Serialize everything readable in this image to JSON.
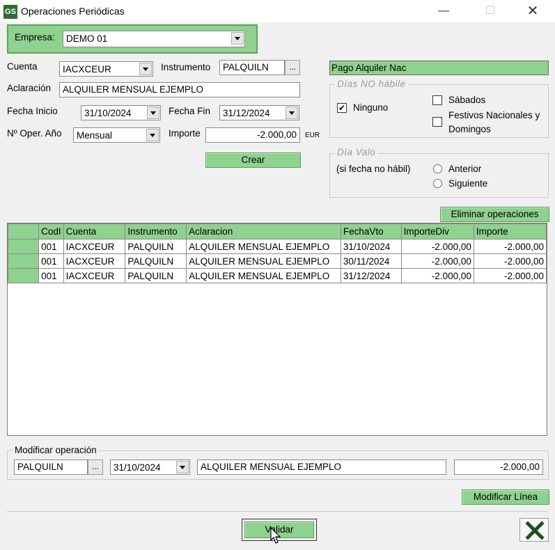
{
  "window": {
    "app_icon": "GS",
    "title": "Operaciones Periódicas",
    "minimize_icon": "minimize-icon",
    "maximize_icon": "maximize-icon",
    "close_icon": "close-icon"
  },
  "empresa": {
    "label": "Empresa:",
    "value": "DEMO 01"
  },
  "form": {
    "cuenta_label": "Cuenta",
    "cuenta_value": "IACXCEUR",
    "instrumento_label": "Instrumento",
    "instrumento_value": "PALQUILN",
    "ellipsis": "...",
    "aclaracion_label": "Aclaración",
    "aclaracion_value": "ALQUILER MENSUAL EJEMPLO",
    "fecha_inicio_label": "Fecha Inicio",
    "fecha_inicio_value": "31/10/2024",
    "fecha_fin_label": "Fecha Fin",
    "fecha_fin_value": "31/12/2024",
    "noper_label": "Nº Oper. Año",
    "noper_value": "Mensual",
    "importe_label": "Importe",
    "importe_value": "-2.000,00",
    "currency": "EUR",
    "crear_label": "Crear"
  },
  "instrument_desc": "Pago Alquiler Nac",
  "dias_no_habiles": {
    "title": "Días NO hábile",
    "ninguno_label": "Ninguno",
    "ninguno_checked": true,
    "sabados_label": "Sábados",
    "sabados_checked": false,
    "festivos_label_1": "Festivos Nacionales y",
    "festivos_label_2": "Domingos",
    "festivos_checked": false
  },
  "dia_valor": {
    "title": "Día Valo",
    "caption": "(si fecha no hábil)",
    "anterior_label": "Anterior",
    "siguiente_label": "Siguiente"
  },
  "eliminar_label": "Eliminar operaciones",
  "grid": {
    "columns": [
      "",
      "CodI",
      "Cuenta",
      "Instrumento",
      "Aclaracion",
      "FechaVto",
      "ImporteDiv",
      "Importe"
    ],
    "rows": [
      [
        "",
        "001",
        "IACXCEUR",
        "PALQUILN",
        "ALQUILER MENSUAL EJEMPLO",
        "31/10/2024",
        "-2.000,00",
        "-2.000,00"
      ],
      [
        "",
        "001",
        "IACXCEUR",
        "PALQUILN",
        "ALQUILER MENSUAL EJEMPLO",
        "30/11/2024",
        "-2.000,00",
        "-2.000,00"
      ],
      [
        "",
        "001",
        "IACXCEUR",
        "PALQUILN",
        "ALQUILER MENSUAL EJEMPLO",
        "31/12/2024",
        "-2.000,00",
        "-2.000,00"
      ]
    ]
  },
  "modificar": {
    "title": "Modificar operación",
    "instrumento": "PALQUILN",
    "ellipsis": "...",
    "fecha": "31/10/2024",
    "aclaracion": "ALQUILER MENSUAL EJEMPLO",
    "importe": "-2.000,00",
    "button_label": "Modificar Línea"
  },
  "validar_label": "Validar",
  "exit_icon": "exit-x-icon"
}
